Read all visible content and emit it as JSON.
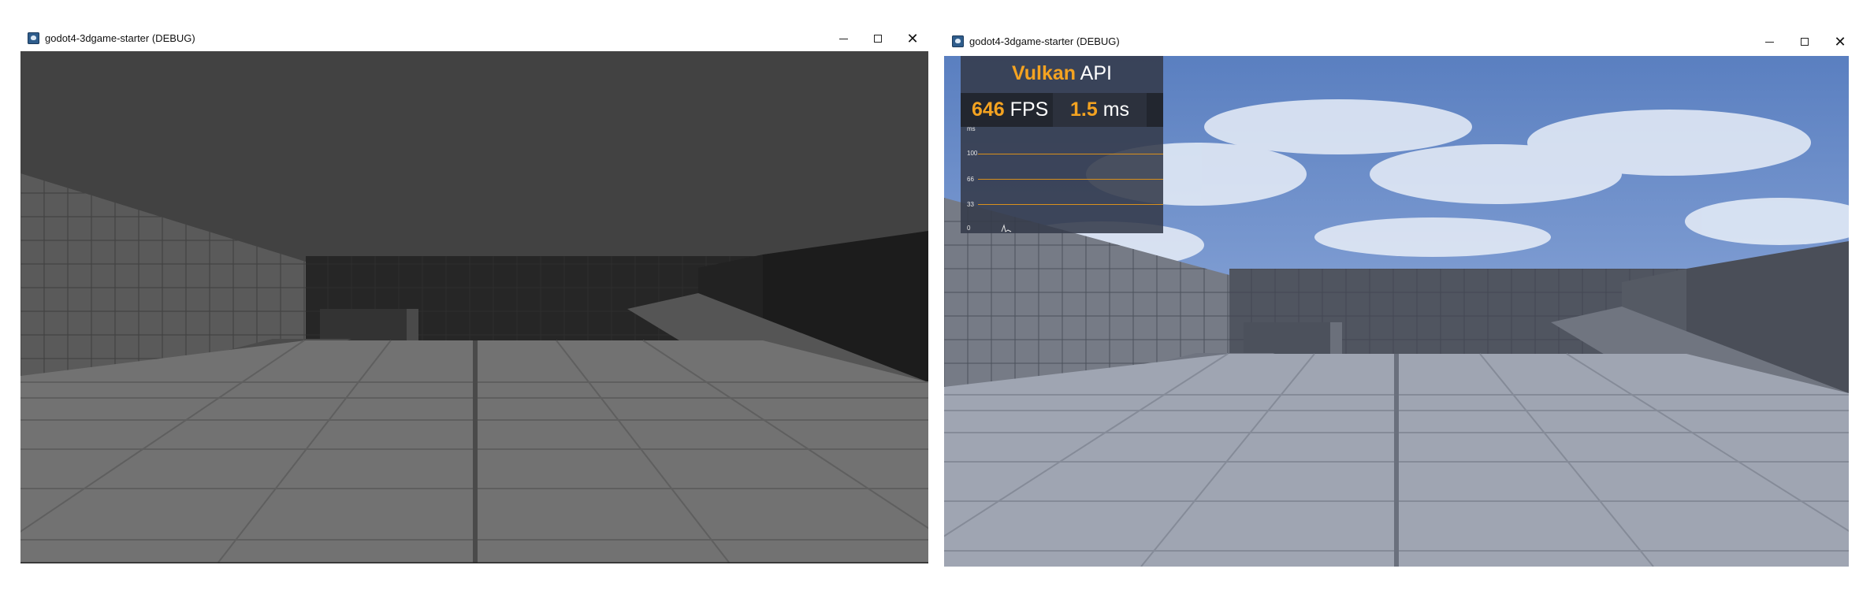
{
  "windows": [
    {
      "title": "godot4-3dgame-starter (DEBUG)",
      "scene": "unshaded"
    },
    {
      "title": "godot4-3dgame-starter (DEBUG)",
      "scene": "sky",
      "overlay": {
        "api_name": "Vulkan",
        "api_suffix": "API",
        "fps_value": "646",
        "fps_unit": "FPS",
        "ms_value": "1.5",
        "ms_unit": "ms",
        "graph_unit": "ms",
        "graph_ticks": [
          "100",
          "66",
          "33",
          "0"
        ]
      }
    }
  ],
  "icons": {
    "app": "godot-app-icon",
    "minimize": "minimize-icon",
    "maximize": "maximize-icon",
    "close": "close-icon"
  },
  "colors": {
    "accent": "#f4a321",
    "overlay_bg": "#343a4a"
  }
}
